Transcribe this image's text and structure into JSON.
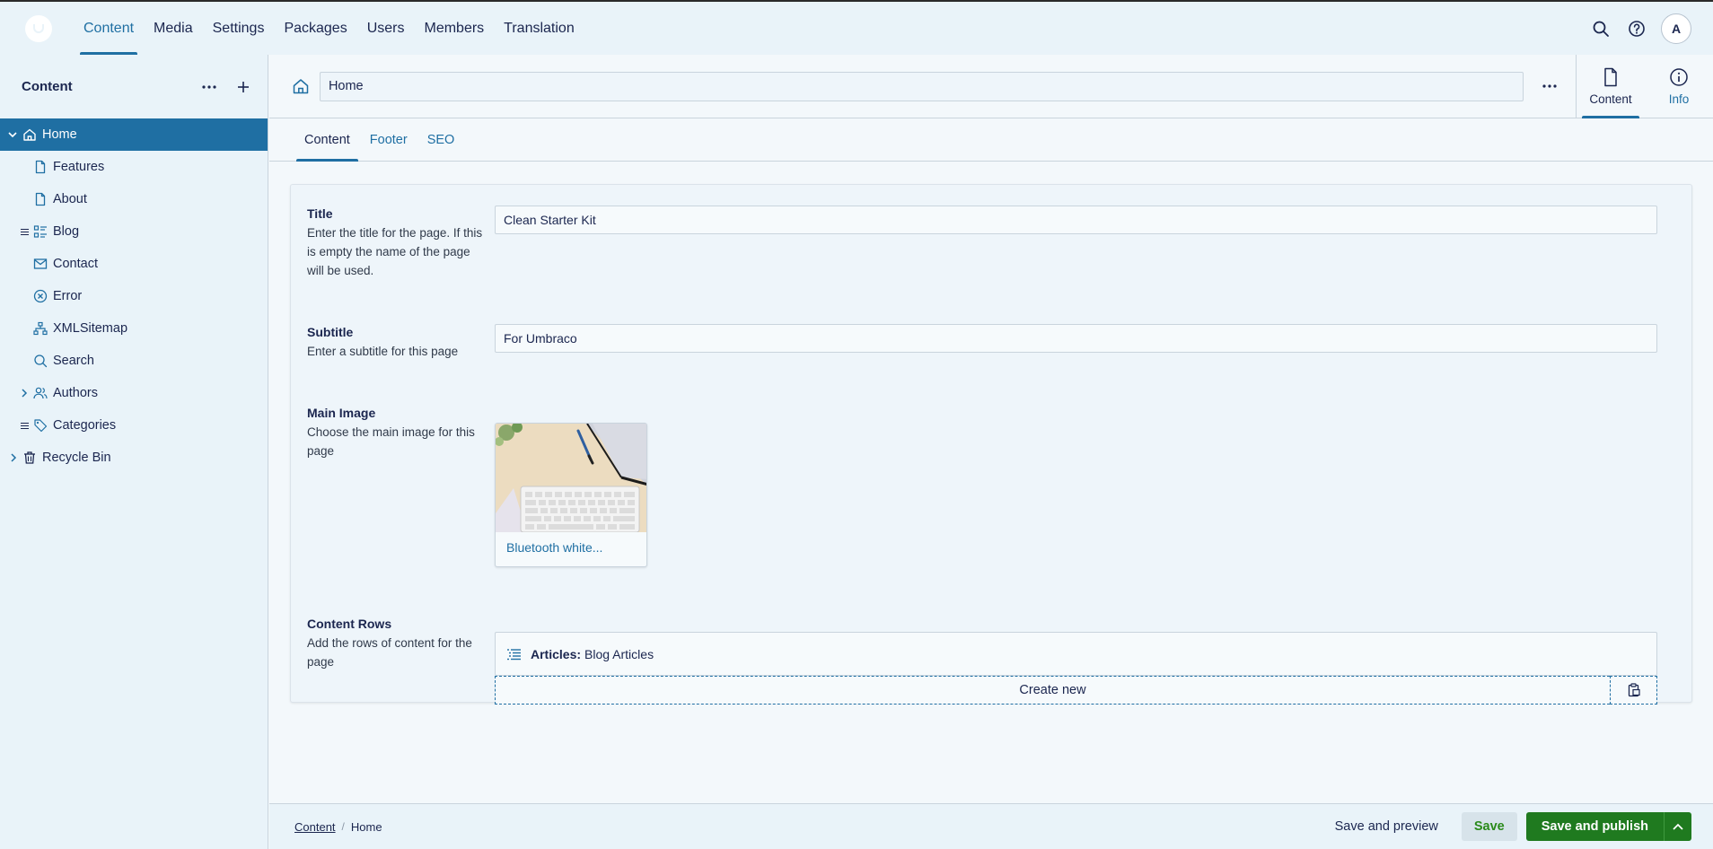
{
  "topbar": {
    "sections": [
      {
        "label": "Content",
        "active": true
      },
      {
        "label": "Media",
        "active": false
      },
      {
        "label": "Settings",
        "active": false
      },
      {
        "label": "Packages",
        "active": false
      },
      {
        "label": "Users",
        "active": false
      },
      {
        "label": "Members",
        "active": false
      },
      {
        "label": "Translation",
        "active": false
      }
    ],
    "avatar_initial": "A",
    "icons": [
      "search-icon",
      "help-icon"
    ]
  },
  "sidebar": {
    "title": "Content",
    "items": [
      {
        "label": "Home",
        "icon": "home-icon",
        "active": true,
        "expanded": true
      },
      {
        "label": "Features",
        "icon": "document-icon"
      },
      {
        "label": "About",
        "icon": "document-icon"
      },
      {
        "label": "Blog",
        "icon": "list-icon"
      },
      {
        "label": "Contact",
        "icon": "mail-icon"
      },
      {
        "label": "Error",
        "icon": "error-icon"
      },
      {
        "label": "XMLSitemap",
        "icon": "sitemap-icon"
      },
      {
        "label": "Search",
        "icon": "search-icon"
      },
      {
        "label": "Authors",
        "icon": "users-icon"
      },
      {
        "label": "Categories",
        "icon": "tag-icon"
      },
      {
        "label": "Recycle Bin",
        "icon": "trash-icon"
      }
    ]
  },
  "header": {
    "name_value": "Home",
    "views": [
      {
        "label": "Content",
        "icon": "document-icon",
        "active": true
      },
      {
        "label": "Info",
        "icon": "info-icon",
        "active": false
      }
    ]
  },
  "tabs": [
    {
      "label": "Content",
      "active": true
    },
    {
      "label": "Footer",
      "active": false
    },
    {
      "label": "SEO",
      "active": false
    }
  ],
  "properties": {
    "title": {
      "label": "Title",
      "description": "Enter the title for the page. If this is empty the name of the page will be used.",
      "value": "Clean Starter Kit"
    },
    "subtitle": {
      "label": "Subtitle",
      "description": "Enter a subtitle for this page",
      "value": "For Umbraco"
    },
    "main_image": {
      "label": "Main Image",
      "description": "Choose the main image for this page",
      "media_name": "Bluetooth white..."
    },
    "content_rows": {
      "label": "Content Rows",
      "description": "Add the rows of content for the page",
      "block_type": "Articles:",
      "block_name": "Blog Articles",
      "create_label": "Create new"
    }
  },
  "footer": {
    "breadcrumb": [
      "Content",
      "Home"
    ],
    "save_preview_label": "Save and preview",
    "save_label": "Save",
    "save_publish_label": "Save and publish"
  },
  "colors": {
    "accent": "#1f6fa3",
    "publish": "#1f7a1f",
    "save_text": "#2a8a1a",
    "background": "#f3f8fb",
    "sidebar_bg": "#e9f3f9"
  }
}
